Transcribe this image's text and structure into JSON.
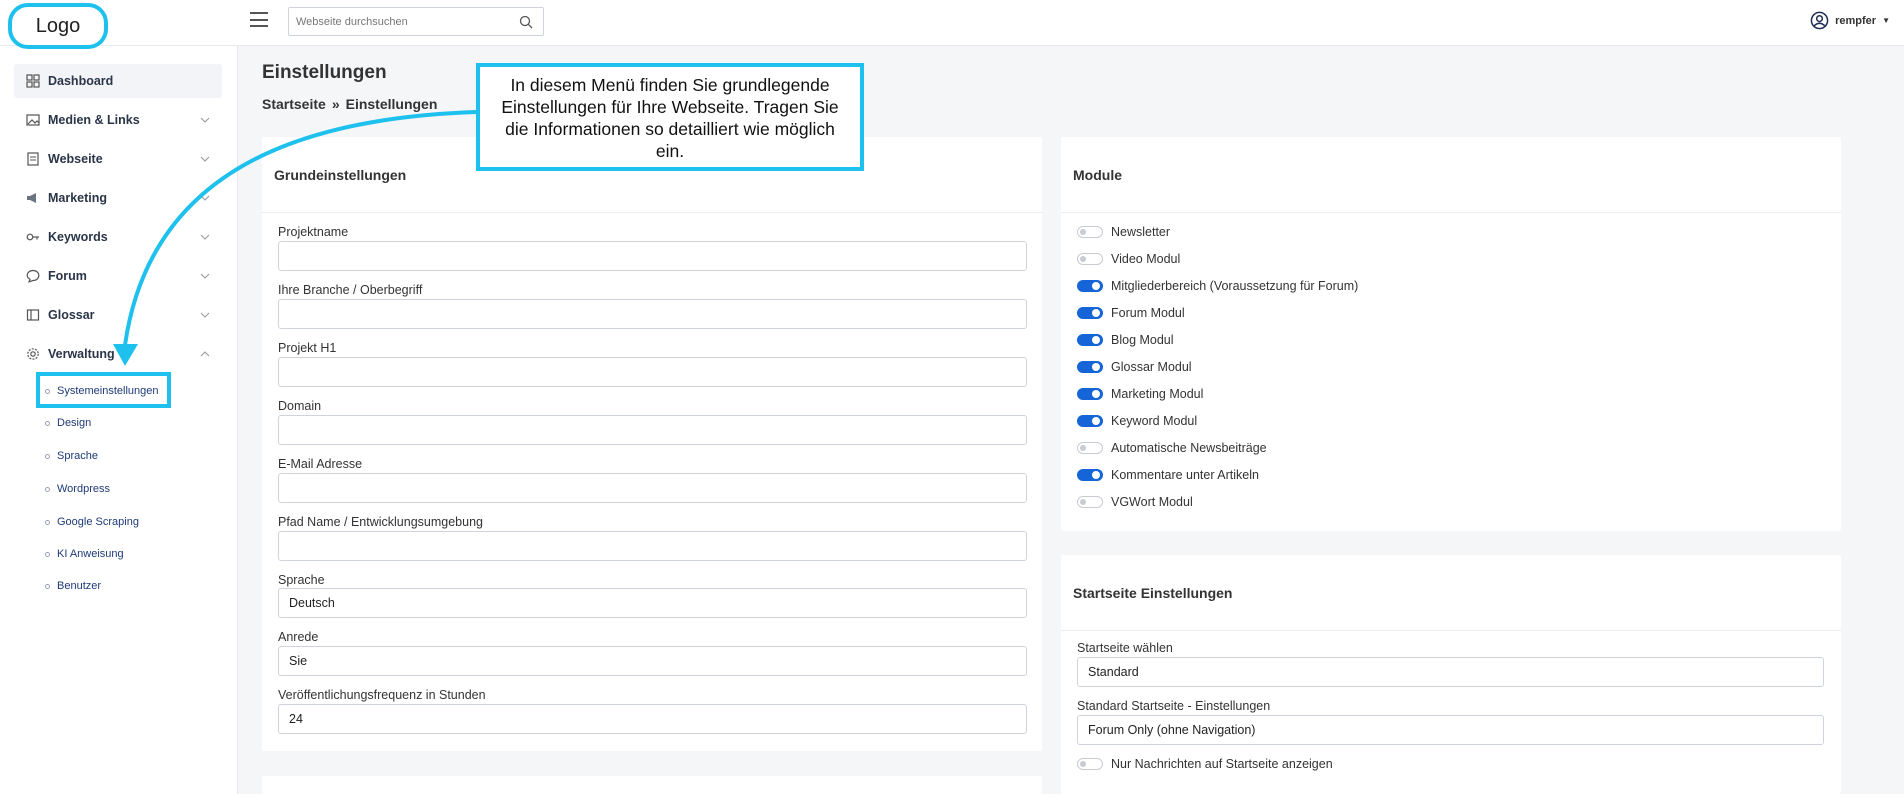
{
  "topbar": {
    "logo": "Logo",
    "search_placeholder": "Webseite durchsuchen",
    "user_name": "rempfer"
  },
  "sidebar": {
    "items": [
      {
        "label": "Dashboard",
        "icon": "grid-icon"
      },
      {
        "label": "Medien & Links",
        "icon": "image-icon"
      },
      {
        "label": "Webseite",
        "icon": "page-icon"
      },
      {
        "label": "Marketing",
        "icon": "megaphone-icon"
      },
      {
        "label": "Keywords",
        "icon": "key-icon"
      },
      {
        "label": "Forum",
        "icon": "chat-icon"
      },
      {
        "label": "Glossar",
        "icon": "book-icon"
      },
      {
        "label": "Verwaltung",
        "icon": "gear-icon"
      }
    ],
    "sub_items": [
      "Systemeinstellungen",
      "Design",
      "Sprache",
      "Wordpress",
      "Google Scraping",
      "KI Anweisung",
      "Benutzer"
    ]
  },
  "page": {
    "title": "Einstellungen",
    "breadcrumb": [
      "Startseite",
      "»",
      "Einstellungen"
    ]
  },
  "callout": {
    "text": "In diesem Menü finden Sie grundlegende Einstellungen für Ihre Webseite. Tragen Sie die Informationen so detailliert wie möglich ein."
  },
  "grundeinstellungen": {
    "title": "Grundeinstellungen",
    "fields": [
      {
        "label": "Projektname",
        "value": ""
      },
      {
        "label": "Ihre Branche / Oberbegriff",
        "value": ""
      },
      {
        "label": "Projekt H1",
        "value": ""
      },
      {
        "label": "Domain",
        "value": ""
      },
      {
        "label": "E-Mail Adresse",
        "value": ""
      },
      {
        "label": "Pfad Name / Entwicklungsumgebung",
        "value": ""
      },
      {
        "label": "Sprache",
        "value": "Deutsch"
      },
      {
        "label": "Anrede",
        "value": "Sie"
      },
      {
        "label": "Veröffentlichungsfrequenz in Stunden",
        "value": "24"
      }
    ]
  },
  "module": {
    "title": "Module",
    "toggles": [
      {
        "label": "Newsletter",
        "on": false
      },
      {
        "label": "Video Modul",
        "on": false
      },
      {
        "label": "Mitgliederbereich (Voraussetzung für Forum)",
        "on": true
      },
      {
        "label": "Forum Modul",
        "on": true
      },
      {
        "label": "Blog Modul",
        "on": true
      },
      {
        "label": "Glossar Modul",
        "on": true
      },
      {
        "label": "Marketing Modul",
        "on": true
      },
      {
        "label": "Keyword Modul",
        "on": true
      },
      {
        "label": "Automatische Newsbeiträge",
        "on": false
      },
      {
        "label": "Kommentare unter Artikeln",
        "on": true
      },
      {
        "label": "VGWort Modul",
        "on": false
      }
    ]
  },
  "startseite": {
    "title": "Startseite Einstellungen",
    "fields": [
      {
        "label": "Startseite wählen",
        "value": "Standard"
      },
      {
        "label": "Standard Startseite - Einstellungen",
        "value": "Forum Only (ohne Navigation)"
      }
    ],
    "toggle": {
      "label": "Nur Nachrichten auf Startseite anzeigen",
      "on": false
    }
  },
  "colors": {
    "accent": "#1565d8",
    "highlight": "#1ec0ee"
  }
}
